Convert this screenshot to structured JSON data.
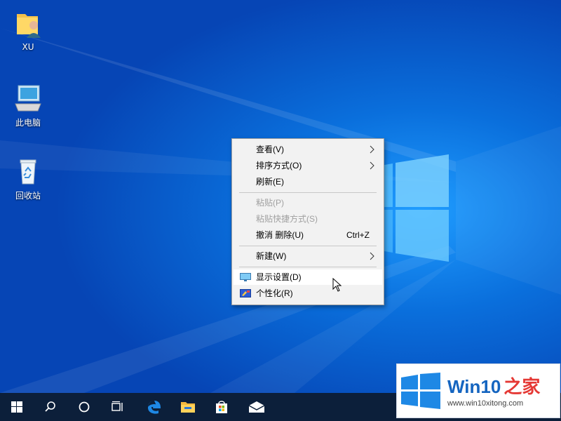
{
  "desktop": {
    "icons": [
      {
        "label": "XU",
        "icon": "user-folder-icon"
      },
      {
        "label": "此电脑",
        "icon": "computer-icon"
      },
      {
        "label": "回收站",
        "icon": "recycle-bin-icon"
      }
    ]
  },
  "context_menu": {
    "items": [
      {
        "label": "查看(V)",
        "submenu": true
      },
      {
        "label": "排序方式(O)",
        "submenu": true
      },
      {
        "label": "刷新(E)"
      },
      {
        "label": "粘贴(P)",
        "disabled": true
      },
      {
        "label": "粘贴快捷方式(S)",
        "disabled": true
      },
      {
        "label": "撤消 删除(U)",
        "shortcut": "Ctrl+Z"
      },
      {
        "label": "新建(W)",
        "submenu": true
      },
      {
        "label": "显示设置(D)",
        "icon": "display-settings-icon",
        "highlighted": true
      },
      {
        "label": "个性化(R)",
        "icon": "personalize-icon"
      }
    ]
  },
  "taskbar": {
    "buttons": [
      "start-icon",
      "search-icon",
      "cortana-icon",
      "task-view-icon",
      "edge-icon",
      "file-explorer-icon",
      "store-icon",
      "mail-icon"
    ]
  },
  "watermark": {
    "brand_win": "Win10",
    "brand_rest": "之家",
    "url": "www.win10xitong.com"
  },
  "colors": {
    "desktop": "#0a6fdc",
    "taskbar": "#0c1f3a",
    "menu_bg": "#f2f2f2",
    "disabled_text": "#a0a0a0",
    "watermark_blue": "#1565c0"
  }
}
